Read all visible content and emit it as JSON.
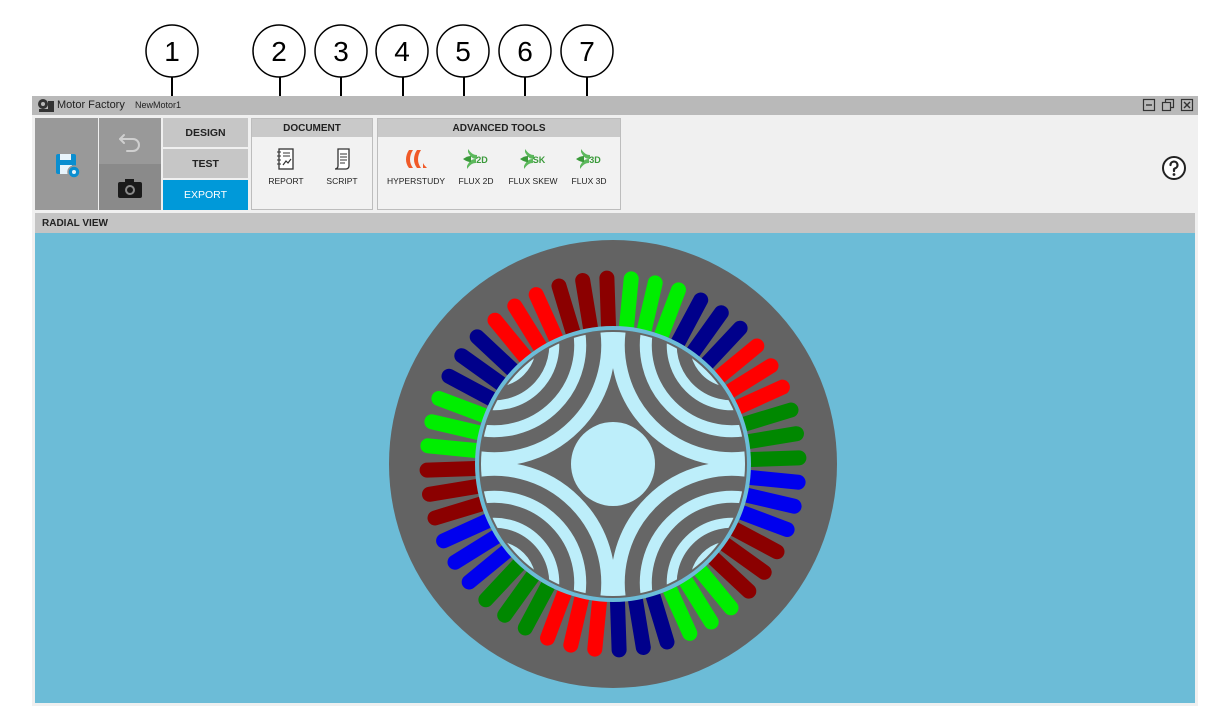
{
  "callouts": [
    "1",
    "2",
    "3",
    "4",
    "5",
    "6",
    "7"
  ],
  "titlebar": {
    "app_title": "Motor Factory",
    "doc_title": "NewMotor1"
  },
  "modes": {
    "design": "DESIGN",
    "test": "TEST",
    "export": "EXPORT",
    "active": "EXPORT"
  },
  "document": {
    "header": "DOCUMENT",
    "report": "REPORT",
    "script": "SCRIPT"
  },
  "advanced": {
    "header": "ADVANCED TOOLS",
    "hyperstudy": "HYPERSTUDY",
    "flux2d": "FLUX 2D",
    "fluxskew": "FLUX SKEW",
    "flux3d": "FLUX 3D",
    "flux2d_badge": "2D",
    "fluxskew_badge": "SK",
    "flux3d_badge": "3D"
  },
  "view": {
    "header": "RADIAL VIEW"
  },
  "colors": {
    "accent": "#0099d9",
    "viewport_bg": "#6cbcd7",
    "stator": "#636363",
    "rotor_magnet": "#bdeefa",
    "phase_dark_red": "#8b0000",
    "phase_green": "#00ee00",
    "phase_dark_blue": "#00008b",
    "phase_red": "#ff0000",
    "phase_dark_green": "#008800",
    "phase_blue": "#0000ee"
  },
  "icons": {
    "save": "save-gear-icon",
    "undo": "undo-icon",
    "camera": "camera-icon",
    "report": "report-document-icon",
    "script": "script-scroll-icon",
    "hyperstudy": "hyperstudy-logo-icon",
    "flux": "flux-logo-icon",
    "help": "help-question-icon"
  }
}
